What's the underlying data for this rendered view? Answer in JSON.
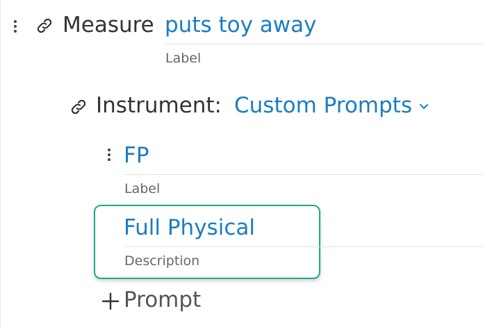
{
  "measure": {
    "heading": "Measure",
    "value": "puts toy away",
    "field_label": "Label"
  },
  "instrument": {
    "heading": "Instrument:",
    "selected": "Custom Prompts"
  },
  "prompt": {
    "value": "FP",
    "field_label": "Label",
    "description_value": "Full Physical",
    "description_label": "Description"
  },
  "add_prompt": {
    "label": "Prompt"
  },
  "colors": {
    "link_blue": "#1a7dc4",
    "focus_ring": "#22a68b",
    "text": "#333333",
    "muted": "#666666"
  },
  "icons": [
    "kebab-menu-icon",
    "link-icon",
    "chevron-down-icon",
    "plus-icon"
  ]
}
